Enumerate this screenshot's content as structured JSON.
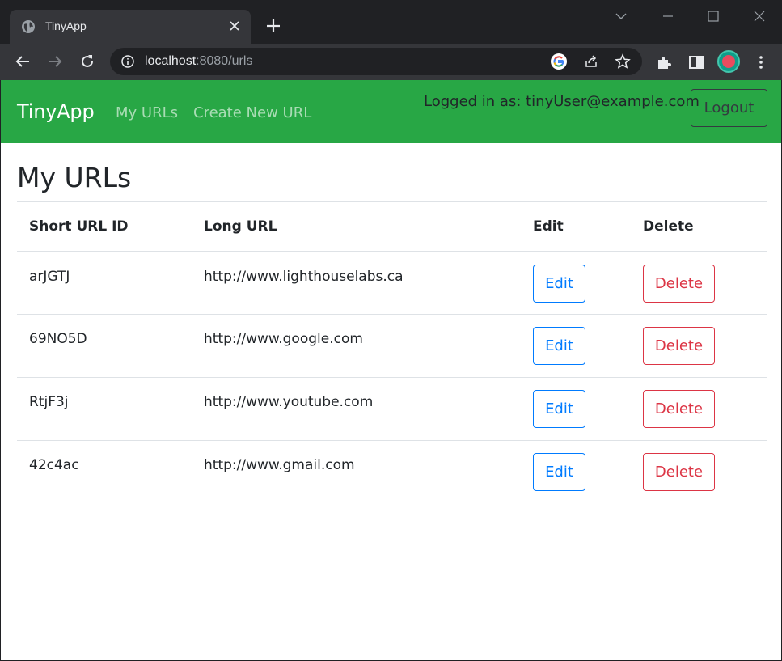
{
  "browser": {
    "tab_title": "TinyApp",
    "url_host": "localhost",
    "url_rest": ":8080/urls"
  },
  "nav": {
    "brand": "TinyApp",
    "links": [
      "My URLs",
      "Create New URL"
    ],
    "login_text": "Logged in as: tinyUser@example.com",
    "logout_label": "Logout"
  },
  "page": {
    "title": "My URLs"
  },
  "table": {
    "headers": [
      "Short URL ID",
      "Long URL",
      "Edit",
      "Delete"
    ],
    "rows": [
      {
        "short_id": "arJGTJ",
        "long_url": "http://www.lighthouselabs.ca",
        "edit": "Edit",
        "delete": "Delete"
      },
      {
        "short_id": "69NO5D",
        "long_url": "http://www.google.com",
        "edit": "Edit",
        "delete": "Delete"
      },
      {
        "short_id": "RtjF3j",
        "long_url": "http://www.youtube.com",
        "edit": "Edit",
        "delete": "Delete"
      },
      {
        "short_id": "42c4ac",
        "long_url": "http://www.gmail.com",
        "edit": "Edit",
        "delete": "Delete"
      }
    ]
  },
  "colors": {
    "navbar": "#28a745",
    "edit": "#007bff",
    "delete": "#dc3545"
  },
  "icons": {
    "tab": "globe-icon",
    "close": "close-icon",
    "new_tab": "plus-icon",
    "back": "back-arrow-icon",
    "forward": "forward-arrow-icon",
    "reload": "reload-icon",
    "site_info": "info-icon",
    "google": "google-icon",
    "share": "share-icon",
    "bookmark": "star-icon",
    "extensions": "puzzle-icon",
    "side_panel": "side-panel-icon",
    "menu": "kebab-menu-icon"
  }
}
